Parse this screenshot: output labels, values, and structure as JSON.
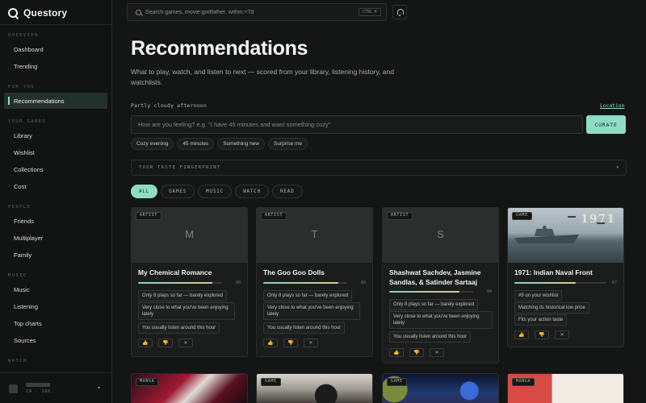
{
  "app": {
    "name": "Questory"
  },
  "search": {
    "placeholder": "Search games, movie:godfather, within:<7d",
    "shortcut": "CTRL K"
  },
  "sidebar": {
    "sections": [
      {
        "label": "OVERVIEW",
        "items": [
          "Dashboard",
          "Trending"
        ]
      },
      {
        "label": "FOR YOU",
        "items": [
          "Recommendations"
        ]
      },
      {
        "label": "YOUR GAMES",
        "items": [
          "Library",
          "Wishlist",
          "Collections",
          "Cost"
        ]
      },
      {
        "label": "PEOPLE",
        "items": [
          "Friends",
          "Multiplayer",
          "Family"
        ]
      },
      {
        "label": "MUSIC",
        "items": [
          "Music",
          "Listening",
          "Top charts",
          "Sources"
        ]
      },
      {
        "label": "WATCH",
        "items": []
      }
    ],
    "active": "Recommendations",
    "user": {
      "status": "IN · INK"
    }
  },
  "main": {
    "title": "Recommendations",
    "subtitle": "What to play, watch, and listen to next — scored from your library, listening history, and watchlists.",
    "weather": "Partly cloudy afternoon",
    "location_link": "Location",
    "mood_placeholder": "How are you feeling? e.g. \"I have 45 minutes and want something cozy\"",
    "curate_label": "CURATE",
    "chips": [
      "Cozy evening",
      "45 minutes",
      "Something new",
      "Surprise me"
    ],
    "fingerprint_label": "YOUR TASTE FINGERPRINT",
    "filters": [
      "ALL",
      "GAMES",
      "MUSIC",
      "WATCH",
      "READ"
    ],
    "active_filter": "ALL"
  },
  "cards": [
    {
      "type": "ARTIST",
      "initial": "M",
      "title": "My Chemical Romance",
      "score": 88,
      "reasons": [
        "Only 8 plays so far — barely explored",
        "Very close to what you've been enjoying lately",
        "You usually listen around this hour"
      ]
    },
    {
      "type": "ARTIST",
      "initial": "T",
      "title": "The Goo Goo Dolls",
      "score": 89,
      "reasons": [
        "Only 8 plays so far — barely explored",
        "Very close to what you've been enjoying lately",
        "You usually listen around this hour"
      ]
    },
    {
      "type": "ARTIST",
      "initial": "S",
      "title": "Shashwat Sachdev, Jasmine Sandlas, & Satinder Sartaaj",
      "score": 84,
      "reasons": [
        "Only 8 plays so far — barely explored",
        "Very close to what you've been enjoying lately",
        "You usually listen around this hour"
      ]
    },
    {
      "type": "GAME",
      "art_title": "1971",
      "title": "1971: Indian Naval Front",
      "score": 67,
      "reasons": [
        "#9 on your wishlist",
        "Matching its historical low price",
        "Fits your action taste"
      ]
    }
  ],
  "bottom_row": [
    "MANGA",
    "GAME",
    "GAME",
    "MANGA"
  ],
  "actions": {
    "like": "👍",
    "dislike": "👎",
    "dismiss": "✕"
  },
  "colors": {
    "accent": "#8fdcc4",
    "background": "#141515",
    "card": "#1b1d1d"
  }
}
